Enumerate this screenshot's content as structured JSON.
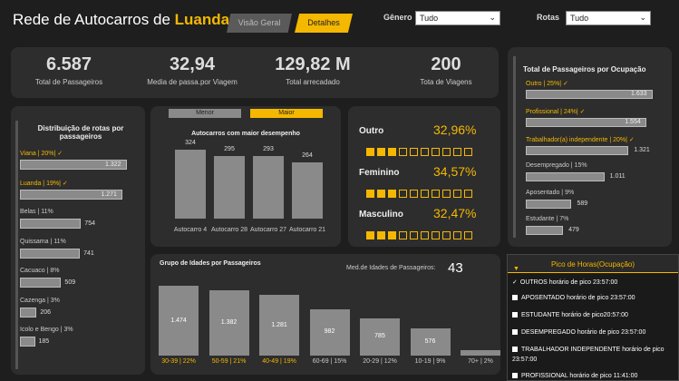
{
  "header": {
    "title_prefix": "Rede de Autocarros de ",
    "title_highlight": "Luanda",
    "tab_overview": "Visão Geral",
    "tab_details": "Detalhes",
    "gender_label": "Gênero",
    "gender_value": "Tudo",
    "routes_label": "Rotas",
    "routes_value": "Tudo"
  },
  "kpis": [
    {
      "value": "6.587",
      "label": "Total de Passageiros"
    },
    {
      "value": "32,94",
      "label": "Media de passa.por Viagem"
    },
    {
      "value": "129,82 M",
      "label": "Total arrecadado"
    },
    {
      "value": "200",
      "label": "Tota de Viagens"
    }
  ],
  "colors": {
    "accent": "#f5b800",
    "bar": "#8a8a8a",
    "panel": "#2d2d2d",
    "background": "#1e1e1e"
  },
  "route_dist": {
    "title": "Distribuição de rotas por passageiros",
    "items": [
      {
        "label": "Viana | 20%| ✓",
        "value": 1322,
        "value_label": "1.322",
        "highlight": true
      },
      {
        "label": "Luanda | 19%| ✓",
        "value": 1271,
        "value_label": "1.271",
        "highlight": true
      },
      {
        "label": "Belas | 11%",
        "value": 754,
        "value_label": "754",
        "highlight": false
      },
      {
        "label": "Quissama | 11%",
        "value": 741,
        "value_label": "741",
        "highlight": false
      },
      {
        "label": "Cacuaco | 8%",
        "value": 509,
        "value_label": "509",
        "highlight": false
      },
      {
        "label": "Cazenga | 3%",
        "value": 206,
        "value_label": "206",
        "highlight": false
      },
      {
        "label": "Icolo e Bengo | 3%",
        "value": 185,
        "value_label": "185",
        "highlight": false
      }
    ]
  },
  "bus_perf": {
    "toggle_min": "Menor",
    "toggle_max": "Maior",
    "title": "Autocarros com maior desempenho",
    "items": [
      {
        "name": "Autocarro 4",
        "value": 324,
        "value_label": "324"
      },
      {
        "name": "Autocarro 28",
        "value": 295,
        "value_label": "295"
      },
      {
        "name": "Autocarro 27",
        "value": 293,
        "value_label": "293"
      },
      {
        "name": "Autocarro 21",
        "value": 264,
        "value_label": "264"
      }
    ]
  },
  "gender": [
    {
      "label": "Outro",
      "pct": "32,96%",
      "filled": 3
    },
    {
      "label": "Feminino",
      "pct": "34,57%",
      "filled": 3
    },
    {
      "label": "Masculino",
      "pct": "32,47%",
      "filled": 3
    }
  ],
  "occupation": {
    "title": "Total de Passageiros por Ocupação",
    "items": [
      {
        "label": "Outro | 25%| ✓",
        "value": 1633,
        "value_label": "1.633",
        "highlight": true
      },
      {
        "label": "Profissional | 24%| ✓",
        "value": 1554,
        "value_label": "1.554",
        "highlight": true
      },
      {
        "label": "Trabalhador(a) independente | 20%| ✓",
        "value": 1321,
        "value_label": "1.321",
        "highlight": true
      },
      {
        "label": "Desempregado | 15%",
        "value": 1011,
        "value_label": "1.011",
        "highlight": false
      },
      {
        "label": "Aposentado | 9%",
        "value": 589,
        "value_label": "589",
        "highlight": false
      },
      {
        "label": "Estudante | 7%",
        "value": 479,
        "value_label": "479",
        "highlight": false
      }
    ]
  },
  "age": {
    "title": "Grupo de Idades por Passageiros",
    "avg_label": "Med.de Idades de Passageiros:",
    "avg_value": "43",
    "items": [
      {
        "label": "30-39 | 22%",
        "value": 1474,
        "value_label": "1.474",
        "highlight": true
      },
      {
        "label": "50-59 | 21%",
        "value": 1382,
        "value_label": "1.382",
        "highlight": true
      },
      {
        "label": "40-49 | 19%",
        "value": 1281,
        "value_label": "1.281",
        "highlight": true
      },
      {
        "label": "60-69 | 15%",
        "value": 982,
        "value_label": "982",
        "highlight": false
      },
      {
        "label": "20-29 | 12%",
        "value": 785,
        "value_label": "785",
        "highlight": false
      },
      {
        "label": "10-19 | 9%",
        "value": 576,
        "value_label": "576",
        "highlight": false
      },
      {
        "label": "70+ | 2%",
        "value": 121,
        "value_label": "",
        "highlight": false
      }
    ]
  },
  "peak": {
    "title": "Pico de Horas(Ocupação)",
    "items": [
      {
        "label": "OUTROS horário de pico 23:57:00",
        "checked": true
      },
      {
        "label": "APOSENTADO horário de pico 23:57:00",
        "checked": false
      },
      {
        "label": "ESTUDANTE horário de pico20:57:00",
        "checked": false
      },
      {
        "label": "DESEMPREGADO horário de pico 23:57:00",
        "checked": false
      },
      {
        "label": "TRABALHADOR INDEPENDENTE horário de pico 23:57:00",
        "checked": false
      },
      {
        "label": "PROFISSIONAL horário de pico 11:41:00",
        "checked": false
      }
    ]
  }
}
